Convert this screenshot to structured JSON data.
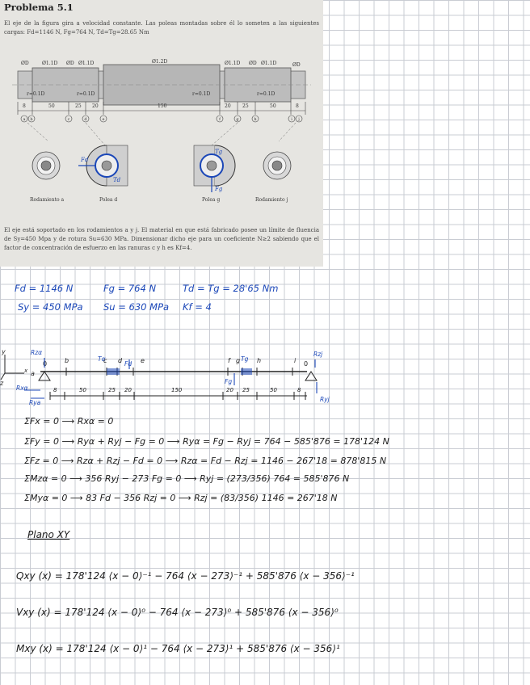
{
  "problem": {
    "title": "Problema 5.1",
    "statement_1": "El eje de la figura gira a velocidad constante. Las poleas montadas sobre él lo someten a las siguientes cargas: Fd=1146 N, Fg=764 N, Td=Tg=28.65 Nm",
    "statement_2": "El eje está soportado en los rodamientos a y j. El material en que está fabricado posee un límite de fluencia de Sy=450 Mpa y de rotura Su=630 MPa. Dimensionar dicho eje para un coeficiente N≥2 sabiendo que el factor de concentración de esfuerzo en las ranuras c y h es Kf=4."
  },
  "figure": {
    "diameters": [
      "ØD",
      "Ø1.1D",
      "ØD",
      "Ø1.1D",
      "Ø1.2D",
      "Ø1.1D",
      "ØD",
      "Ø1.1D",
      "ØD"
    ],
    "fillets": [
      "r=0.1D",
      "r=0.1D",
      "r=0.1D",
      "r=0.1D"
    ],
    "lengths": [
      "8",
      "50",
      "25",
      "20",
      "150",
      "20",
      "25",
      "50",
      "8"
    ],
    "points": [
      "a",
      "b",
      "c",
      "d",
      "e",
      "f",
      "g",
      "h",
      "i",
      "j"
    ],
    "captions": [
      "Rodamiento a",
      "Polea d",
      "Polea g",
      "Rodamiento j"
    ],
    "force_labels": [
      "Fd",
      "Td",
      "Tg",
      "Fg"
    ]
  },
  "givens": {
    "line1": [
      "Fd = 1146 N",
      "Fg = 764 N",
      "Td = Tg = 28'65 Nm"
    ],
    "line2": [
      "Sy = 450 MPa",
      "Su = 630 MPa",
      "Kf = 4"
    ]
  },
  "sketch": {
    "labels": [
      "Rzα",
      "b",
      "c",
      "Tα",
      "d",
      "Fd",
      "e",
      "f",
      "g",
      "Tg",
      "h",
      "i",
      "Rzj",
      "Rxα",
      "Rya",
      "Fg",
      "Ryj",
      "x",
      "y",
      "z",
      "a",
      "0",
      "0"
    ],
    "dims": [
      "8",
      "50",
      "25",
      "20",
      "150",
      "20",
      "25",
      "50",
      "8"
    ]
  },
  "equations": [
    "ΣFx = 0  ⟶  Rxα = 0",
    "ΣFy = 0  ⟶  Ryα + Ryj − Fg = 0  ⟶  Ryα = Fg − Ryj = 764 − 585'876 = 178'124 N",
    "ΣFz = 0  ⟶  Rzα + Rzj − Fd = 0  ⟶  Rzα = Fd − Rzj = 1146 − 267'18 = 878'815 N",
    "ΣMzα = 0  ⟶  356 Ryj − 273 Fg = 0  ⟶  Ryj = (273/356) 764 = 585'876 N",
    "ΣMyα = 0  ⟶  83 Fd − 356 Rzj = 0  ⟶  Rzj = (83/356) 1146 = 267'18 N"
  ],
  "plane_heading": "Plano XY",
  "functions": [
    "Qxy (x) = 178'124 ⟨x − 0⟩⁻¹ − 764 ⟨x − 273⟩⁻¹ + 585'876 ⟨x − 356⟩⁻¹",
    "Vxy (x) = 178'124 ⟨x − 0⟩⁰ − 764 ⟨x − 273⟩⁰ + 585'876 ⟨x − 356⟩⁰",
    "Mxy (x) = 178'124 ⟨x − 0⟩¹ − 764 ⟨x − 273⟩¹ + 585'876 ⟨x − 356⟩¹"
  ]
}
